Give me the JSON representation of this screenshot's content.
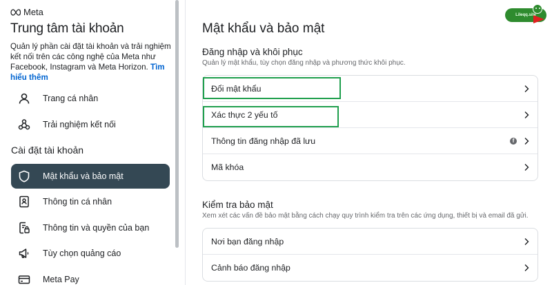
{
  "brand": {
    "logo_text": "Meta"
  },
  "sidebar": {
    "title": "Trung tâm tài khoản",
    "description": "Quản lý phần cài đặt tài khoản và trải nghiệm kết nối trên các công nghệ của Meta như Facebook, Instagram và Meta Horizon.",
    "description_link": "Tìm hiểu thêm",
    "top_items": [
      {
        "label": "Trang cá nhân",
        "icon": "person-icon"
      },
      {
        "label": "Trải nghiệm kết nối",
        "icon": "connected-icon"
      }
    ],
    "section_label": "Cài đặt tài khoản",
    "items": [
      {
        "label": "Mật khẩu và bảo mật",
        "icon": "shield-icon",
        "active": true
      },
      {
        "label": "Thông tin cá nhân",
        "icon": "id-card-icon"
      },
      {
        "label": "Thông tin và quyền của bạn",
        "icon": "document-lock-icon"
      },
      {
        "label": "Tùy chọn quảng cáo",
        "icon": "megaphone-icon"
      },
      {
        "label": "Meta Pay",
        "icon": "card-icon"
      }
    ]
  },
  "main": {
    "title": "Mật khẩu và bảo mật",
    "login_section": {
      "title": "Đăng nhập và khôi phục",
      "description": "Quản lý mật khẩu, tùy chọn đăng nhập và phương thức khôi phục.",
      "rows": [
        {
          "label": "Đổi mật khẩu"
        },
        {
          "label": "Xác thực 2 yếu tố"
        },
        {
          "label": "Thông tin đăng nhập đã lưu",
          "badge": "f"
        },
        {
          "label": "Mã khóa"
        }
      ]
    },
    "security_section": {
      "title": "Kiểm tra bảo mật",
      "description": "Xem xét các vấn đề bảo mật bằng cách chạy quy trình kiểm tra trên các ứng dụng, thiết bị và email đã gửi.",
      "rows": [
        {
          "label": "Nơi bạn đăng nhập"
        },
        {
          "label": "Cảnh báo đăng nhập"
        }
      ]
    }
  },
  "watermark": {
    "text": "Lileqq.site"
  },
  "colors": {
    "active_bg": "#344854",
    "link": "#0064d1",
    "highlight": "#1e9e4c"
  }
}
